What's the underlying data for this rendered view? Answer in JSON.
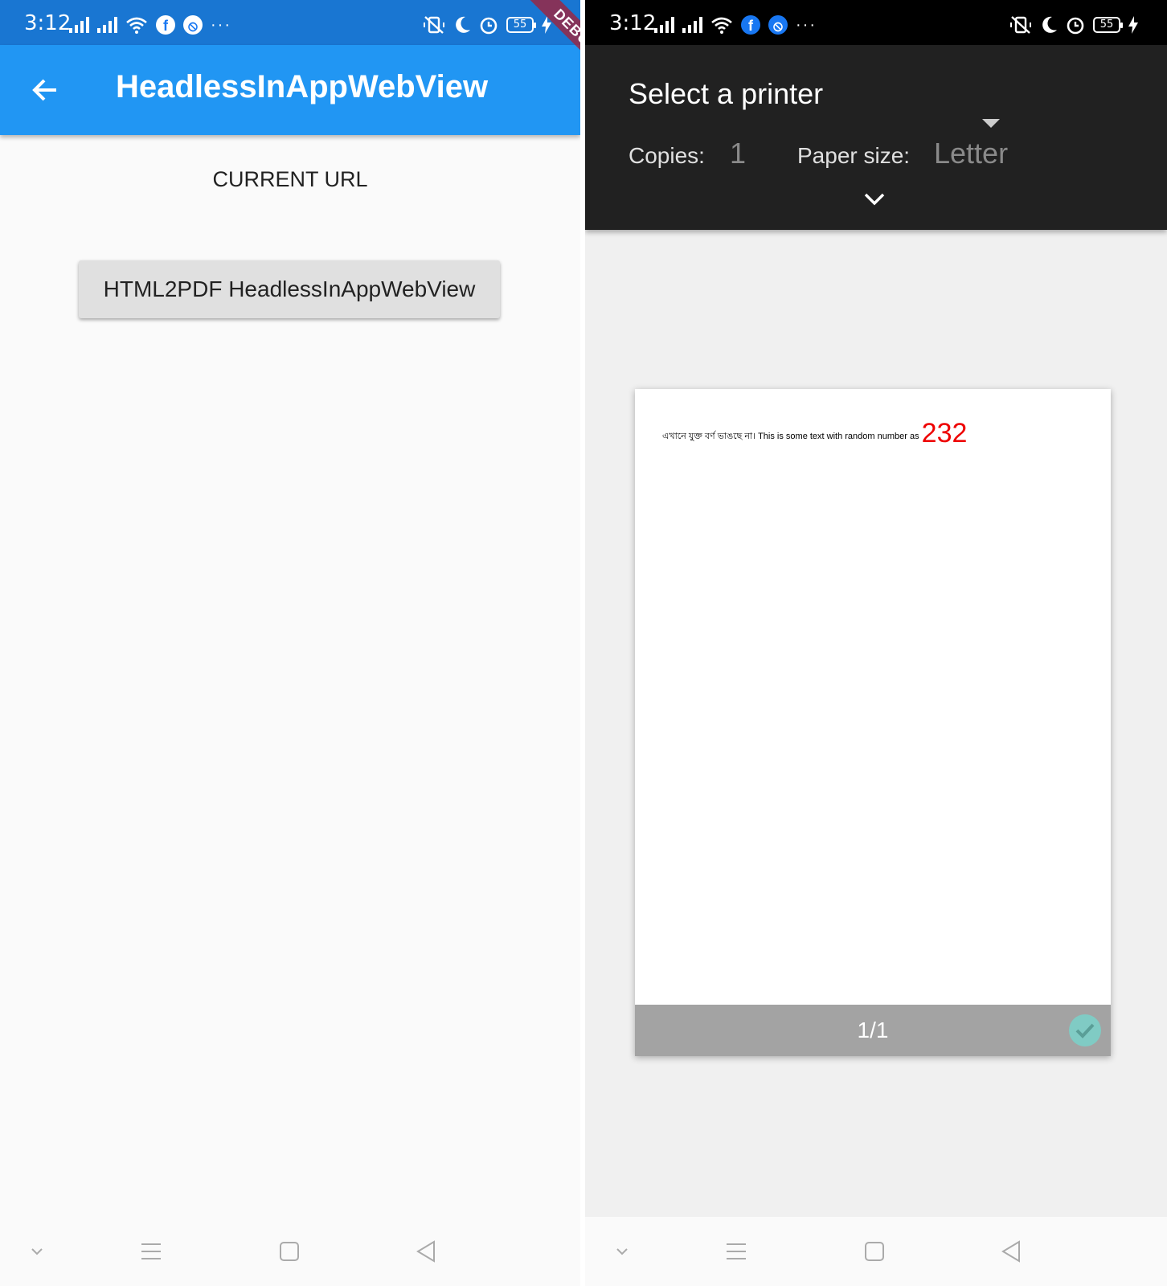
{
  "left": {
    "status_bar": {
      "time": "3:12",
      "battery": "55"
    },
    "app_bar": {
      "title": "HeadlessInAppWebView"
    },
    "debug_banner": "DEBUG",
    "current_url_label": "CURRENT URL",
    "html2pdf_button_label": "HTML2PDF HeadlessInAppWebView"
  },
  "right": {
    "status_bar": {
      "time": "3:12",
      "battery": "55"
    },
    "print_dialog": {
      "printer_select": "Select a printer",
      "copies_label": "Copies:",
      "copies_value": "1",
      "paper_size_label": "Paper size:",
      "paper_size_value": "Letter"
    },
    "preview": {
      "text": "এখানে যুক্ত বর্ণ ভাঙছে না। This is some text with random number as",
      "number": "232",
      "page_count": "1/1"
    }
  },
  "colors": {
    "app_bar": "#2196f3",
    "status_bar_left": "#1976d2",
    "print_header": "#212121",
    "number_red": "#ee0000",
    "check_teal": "#80cbc4"
  }
}
